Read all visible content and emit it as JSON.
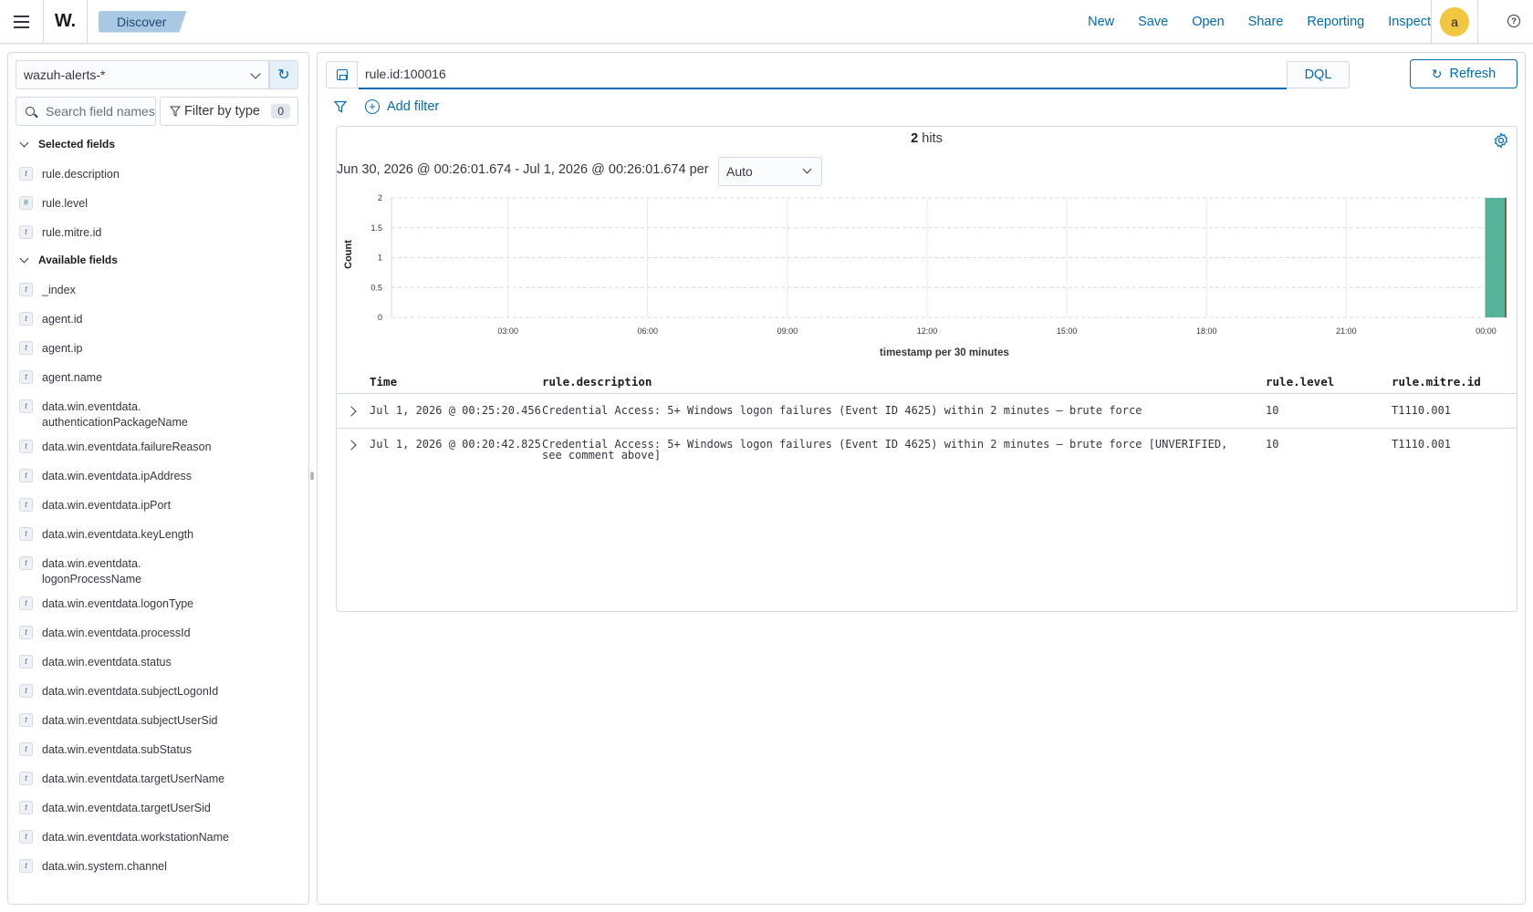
{
  "header": {
    "logo_text": "W.",
    "breadcrumb": "Discover",
    "menu": [
      "New",
      "Save",
      "Open",
      "Share",
      "Reporting",
      "Inspect"
    ],
    "avatar_initial": "a",
    "help_glyph": "?"
  },
  "sidebar": {
    "index_pattern": "wazuh-alerts-*",
    "search_placeholder": "Search field names",
    "filter_by_type_label": "Filter by type",
    "filter_by_type_count": "0",
    "selected_title": "Selected fields",
    "selected_fields": [
      {
        "type": "t",
        "name": "rule.description"
      },
      {
        "type": "#",
        "name": "rule.level"
      },
      {
        "type": "t",
        "name": "rule.mitre.id"
      }
    ],
    "available_title": "Available fields",
    "available_fields": [
      {
        "type": "t",
        "name": "_index"
      },
      {
        "type": "t",
        "name": "agent.id"
      },
      {
        "type": "t",
        "name": "agent.ip"
      },
      {
        "type": "t",
        "name": "agent.name"
      },
      {
        "type": "t",
        "name": "data.win.eventdata.\nauthenticationPackageName"
      },
      {
        "type": "t",
        "name": "data.win.eventdata.failureReason"
      },
      {
        "type": "t",
        "name": "data.win.eventdata.ipAddress"
      },
      {
        "type": "t",
        "name": "data.win.eventdata.ipPort"
      },
      {
        "type": "t",
        "name": "data.win.eventdata.keyLength"
      },
      {
        "type": "t",
        "name": "data.win.eventdata.\nlogonProcessName"
      },
      {
        "type": "t",
        "name": "data.win.eventdata.logonType"
      },
      {
        "type": "t",
        "name": "data.win.eventdata.processId"
      },
      {
        "type": "t",
        "name": "data.win.eventdata.status"
      },
      {
        "type": "t",
        "name": "data.win.eventdata.subjectLogonId"
      },
      {
        "type": "t",
        "name": "data.win.eventdata.subjectUserSid"
      },
      {
        "type": "t",
        "name": "data.win.eventdata.subStatus"
      },
      {
        "type": "t",
        "name": "data.win.eventdata.targetUserName"
      },
      {
        "type": "t",
        "name": "data.win.eventdata.targetUserSid"
      },
      {
        "type": "t",
        "name": "data.win.eventdata.workstationName"
      },
      {
        "type": "t",
        "name": "data.win.system.channel"
      }
    ]
  },
  "query": {
    "text": "rule.id:100016",
    "language": "DQL",
    "refresh_label": "Refresh",
    "add_filter_label": "Add filter"
  },
  "results": {
    "hits_count": "2",
    "hits_label": "hits",
    "time_range": "Jun 30, 2026 @ 00:26:01.674 - Jul 1, 2026 @ 00:26:01.674 per",
    "interval": "Auto"
  },
  "chart_data": {
    "type": "bar",
    "xlabel": "timestamp per 30 minutes",
    "ylabel": "Count",
    "ylim": [
      0,
      2
    ],
    "yticks": [
      "0",
      "0.5",
      "1",
      "1.5",
      "2"
    ],
    "xticks": [
      "03:00",
      "06:00",
      "09:00",
      "12:00",
      "15:00",
      "18:00",
      "21:00",
      "00:00"
    ],
    "x": [
      "00:00"
    ],
    "values": [
      2
    ],
    "grid": true,
    "bar_color": "#54b399"
  },
  "table": {
    "columns": [
      "Time",
      "rule.description",
      "rule.level",
      "rule.mitre.id"
    ],
    "rows": [
      {
        "time": "Jul 1, 2026 @ 00:25:20.456",
        "description": "Credential Access: 5+ Windows logon failures (Event ID 4625) within 2 minutes — brute force",
        "level": "10",
        "mitre": "T1110.001"
      },
      {
        "time": "Jul 1, 2026 @ 00:20:42.825",
        "description": "Credential Access: 5+ Windows logon failures (Event ID 4625) within 2 minutes — brute force [UNVERIFIED, see comment above]",
        "level": "10",
        "mitre": "T1110.001"
      }
    ]
  }
}
